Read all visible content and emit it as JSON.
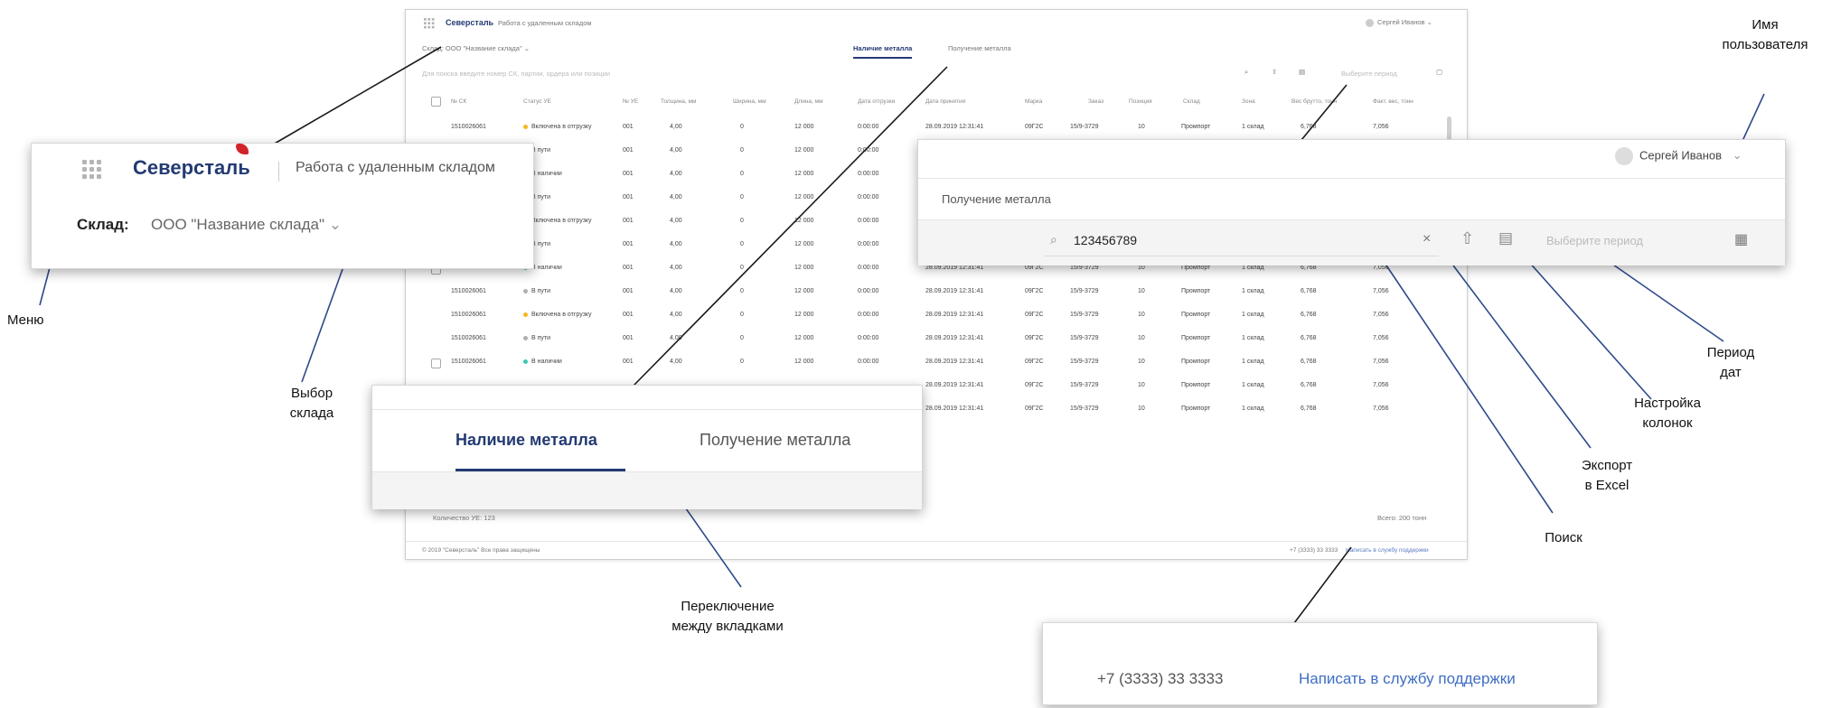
{
  "header": {
    "logo": "Северсталь",
    "app_title": "Работа с удаленным складом",
    "user_name": "Сергей Иванов"
  },
  "warehouse": {
    "label": "Склад:",
    "value": "ООО \"Название склада\""
  },
  "tabs": [
    {
      "label": "Наличие металла",
      "active": true
    },
    {
      "label": "Получение металла",
      "active": false
    }
  ],
  "toolbar": {
    "search_placeholder": "Для поиска введите номер СК, партии, ордера или позиции",
    "search_value": "123456789",
    "period_placeholder": "Выберите период"
  },
  "table": {
    "columns": [
      "№ СК",
      "Статус УЕ",
      "№ УЕ",
      "Толщина, мм",
      "Ширина, мм",
      "Длина, мм",
      "Дата отгрузки",
      "Дата принятия",
      "Марка",
      "Заказ",
      "Позиция",
      "Склад",
      "Зона",
      "Вес брутто, тонн",
      "Факт. вес, тонн"
    ],
    "rows": [
      {
        "sk": "1510026061",
        "status": "Включена в отгрузку",
        "status_color": "#f5b820",
        "ue": "001",
        "thickness": "4,00",
        "width": "0",
        "length": "12 000",
        "ship": "0:00:00",
        "accept": "28.09.2019 12:31:41",
        "grade": "09Г2С",
        "order": "15/9-3729",
        "pos": "10",
        "store": "Промпорт",
        "zone": "1 склад",
        "gross": "6,768",
        "fact": "7,056"
      },
      {
        "sk": "1510026061",
        "status": "В пути",
        "status_color": "#b0b0b0",
        "ue": "001",
        "thickness": "4,00",
        "width": "0",
        "length": "12 000",
        "ship": "0:00:00",
        "accept": "28.09.2019 12:31:41",
        "grade": "09Г2С",
        "order": "15/9-3729",
        "pos": "10",
        "store": "Промпорт",
        "zone": "1 склад",
        "gross": "6,768",
        "fact": "7,056"
      },
      {
        "sk": "1510026061",
        "status": "В наличии",
        "status_color": "#3cc7b4",
        "ue": "001",
        "thickness": "4,00",
        "width": "0",
        "length": "12 000",
        "ship": "0:00:00",
        "accept": "28.09.2019 12:31:41",
        "grade": "09Г2С",
        "order": "15/9-3729",
        "pos": "10",
        "store": "Промпорт",
        "zone": "1 склад",
        "gross": "6,768",
        "fact": "7,056"
      },
      {
        "sk": "1510026061",
        "status": "В пути",
        "status_color": "#b0b0b0",
        "ue": "001",
        "thickness": "4,00",
        "width": "0",
        "length": "12 000",
        "ship": "0:00:00",
        "accept": "28.09.2019 12:31:41",
        "grade": "09Г2С",
        "order": "15/9-3729",
        "pos": "10",
        "store": "Промпорт",
        "zone": "1 склад",
        "gross": "6,768",
        "fact": "7,056"
      },
      {
        "sk": "1510026061",
        "status": "Включена в отгрузку",
        "status_color": "#f5b820",
        "ue": "001",
        "thickness": "4,00",
        "width": "0",
        "length": "12 000",
        "ship": "0:00:00",
        "accept": "28.09.2019 12:31:41",
        "grade": "09Г2С",
        "order": "15/9-3729",
        "pos": "10",
        "store": "Промпорт",
        "zone": "1 склад",
        "gross": "6,768",
        "fact": "7,056"
      },
      {
        "sk": "1510026061",
        "status": "В пути",
        "status_color": "#b0b0b0",
        "ue": "001",
        "thickness": "4,00",
        "width": "0",
        "length": "12 000",
        "ship": "0:00:00",
        "accept": "28.09.2019 12:31:41",
        "grade": "09Г2С",
        "order": "15/9-3729",
        "pos": "10",
        "store": "Промпорт",
        "zone": "1 склад",
        "gross": "6,768",
        "fact": "7,056"
      },
      {
        "sk": "1510026061",
        "status": "В наличии",
        "status_color": "#3cc7b4",
        "ue": "001",
        "thickness": "4,00",
        "width": "0",
        "length": "12 000",
        "ship": "0:00:00",
        "accept": "28.09.2019 12:31:41",
        "grade": "09Г2С",
        "order": "15/9-3729",
        "pos": "10",
        "store": "Промпорт",
        "zone": "1 склад",
        "gross": "6,768",
        "fact": "7,056"
      },
      {
        "sk": "1510026061",
        "status": "В пути",
        "status_color": "#b0b0b0",
        "ue": "001",
        "thickness": "4,00",
        "width": "0",
        "length": "12 000",
        "ship": "0:00:00",
        "accept": "28.09.2019 12:31:41",
        "grade": "09Г2С",
        "order": "15/9-3729",
        "pos": "10",
        "store": "Промпорт",
        "zone": "1 склад",
        "gross": "6,768",
        "fact": "7,056"
      },
      {
        "sk": "1510026061",
        "status": "Включена в отгрузку",
        "status_color": "#f5b820",
        "ue": "001",
        "thickness": "4,00",
        "width": "0",
        "length": "12 000",
        "ship": "0:00:00",
        "accept": "28.09.2019 12:31:41",
        "grade": "09Г2С",
        "order": "15/9-3729",
        "pos": "10",
        "store": "Промпорт",
        "zone": "1 склад",
        "gross": "6,768",
        "fact": "7,056"
      },
      {
        "sk": "1510026061",
        "status": "В пути",
        "status_color": "#b0b0b0",
        "ue": "001",
        "thickness": "4,00",
        "width": "0",
        "length": "12 000",
        "ship": "0:00:00",
        "accept": "28.09.2019 12:31:41",
        "grade": "09Г2С",
        "order": "15/9-3729",
        "pos": "10",
        "store": "Промпорт",
        "zone": "1 склад",
        "gross": "6,768",
        "fact": "7,056"
      },
      {
        "sk": "1510026061",
        "status": "В наличии",
        "status_color": "#3cc7b4",
        "ue": "001",
        "thickness": "4,00",
        "width": "0",
        "length": "12 000",
        "ship": "0:00:00",
        "accept": "28.09.2019 12:31:41",
        "grade": "09Г2С",
        "order": "15/9-3729",
        "pos": "10",
        "store": "Промпорт",
        "zone": "1 склад",
        "gross": "6,768",
        "fact": "7,056"
      }
    ],
    "hidden_row_tail": {
      "accept": "28.09.2019 12:31:41",
      "grade": "09Г2С",
      "order": "15/9-3729",
      "pos": "10",
      "store": "Промпорт",
      "zone": "1 склад",
      "gross": "6,768",
      "fact": "7,056"
    }
  },
  "summary": {
    "count": "Количество УЕ: 123",
    "total": "Всего: 200 тонн"
  },
  "footer": {
    "copyright": "© 2019 \"Северсталь\" Все права защищены",
    "phone": "+7 (3333) 33 3333",
    "support_link": "Написать в службу поддержки"
  },
  "callouts": {
    "menu": "Меню",
    "warehouse_select": [
      "Выбор",
      "склада"
    ],
    "tab_switch": [
      "Переключение",
      "между вкладками"
    ],
    "username": [
      "Имя",
      "пользователя"
    ],
    "period": [
      "Период",
      "дат"
    ],
    "columns": [
      "Настройка",
      "колонок"
    ],
    "export": [
      "Экспорт",
      "в Excel"
    ],
    "search": "Поиск"
  },
  "colors": {
    "brand": "#233a73",
    "accent_red": "#d2232a",
    "in_transit": "#b0b0b0",
    "in_stock": "#3cc7b4",
    "shipping": "#f5b820"
  }
}
